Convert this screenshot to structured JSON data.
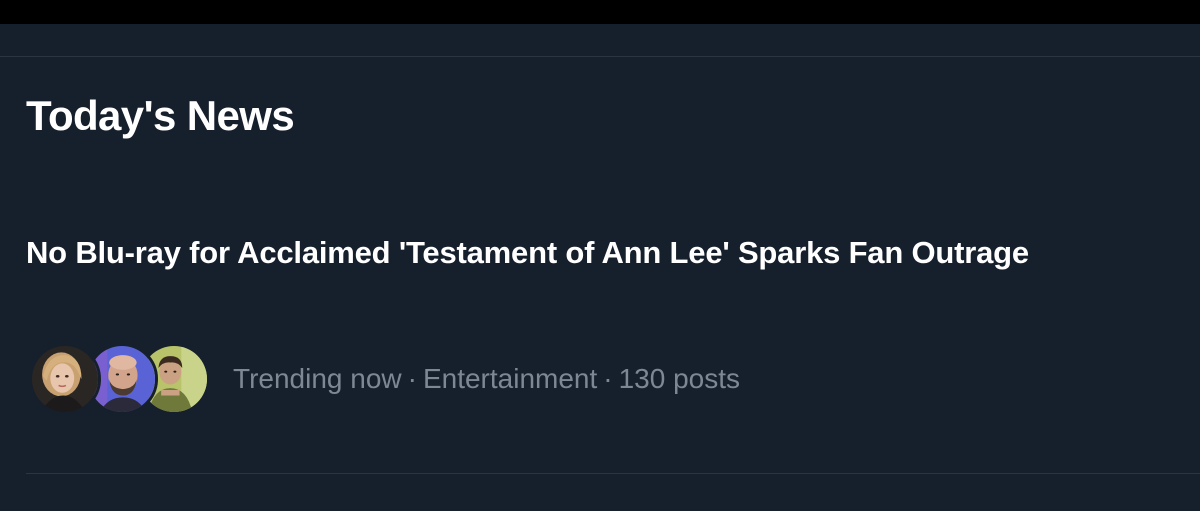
{
  "section": {
    "title": "Today's News"
  },
  "news_item": {
    "headline": "No Blu-ray for Acclaimed 'Testament of Ann Lee' Sparks Fan Outrage",
    "meta": {
      "status": "Trending now",
      "category": "Entertainment",
      "posts": "130 posts",
      "separator": "·"
    },
    "avatars": [
      {
        "name": "avatar-1",
        "depicts": "blonde woman portrait"
      },
      {
        "name": "avatar-2",
        "depicts": "bald bearded man portrait"
      },
      {
        "name": "avatar-3",
        "depicts": "dark-haired man portrait"
      }
    ]
  },
  "colors": {
    "background": "#16202c",
    "top_strip": "#000000",
    "divider": "#2a3542",
    "headline": "#ffffff",
    "meta_text": "#7d8894"
  }
}
